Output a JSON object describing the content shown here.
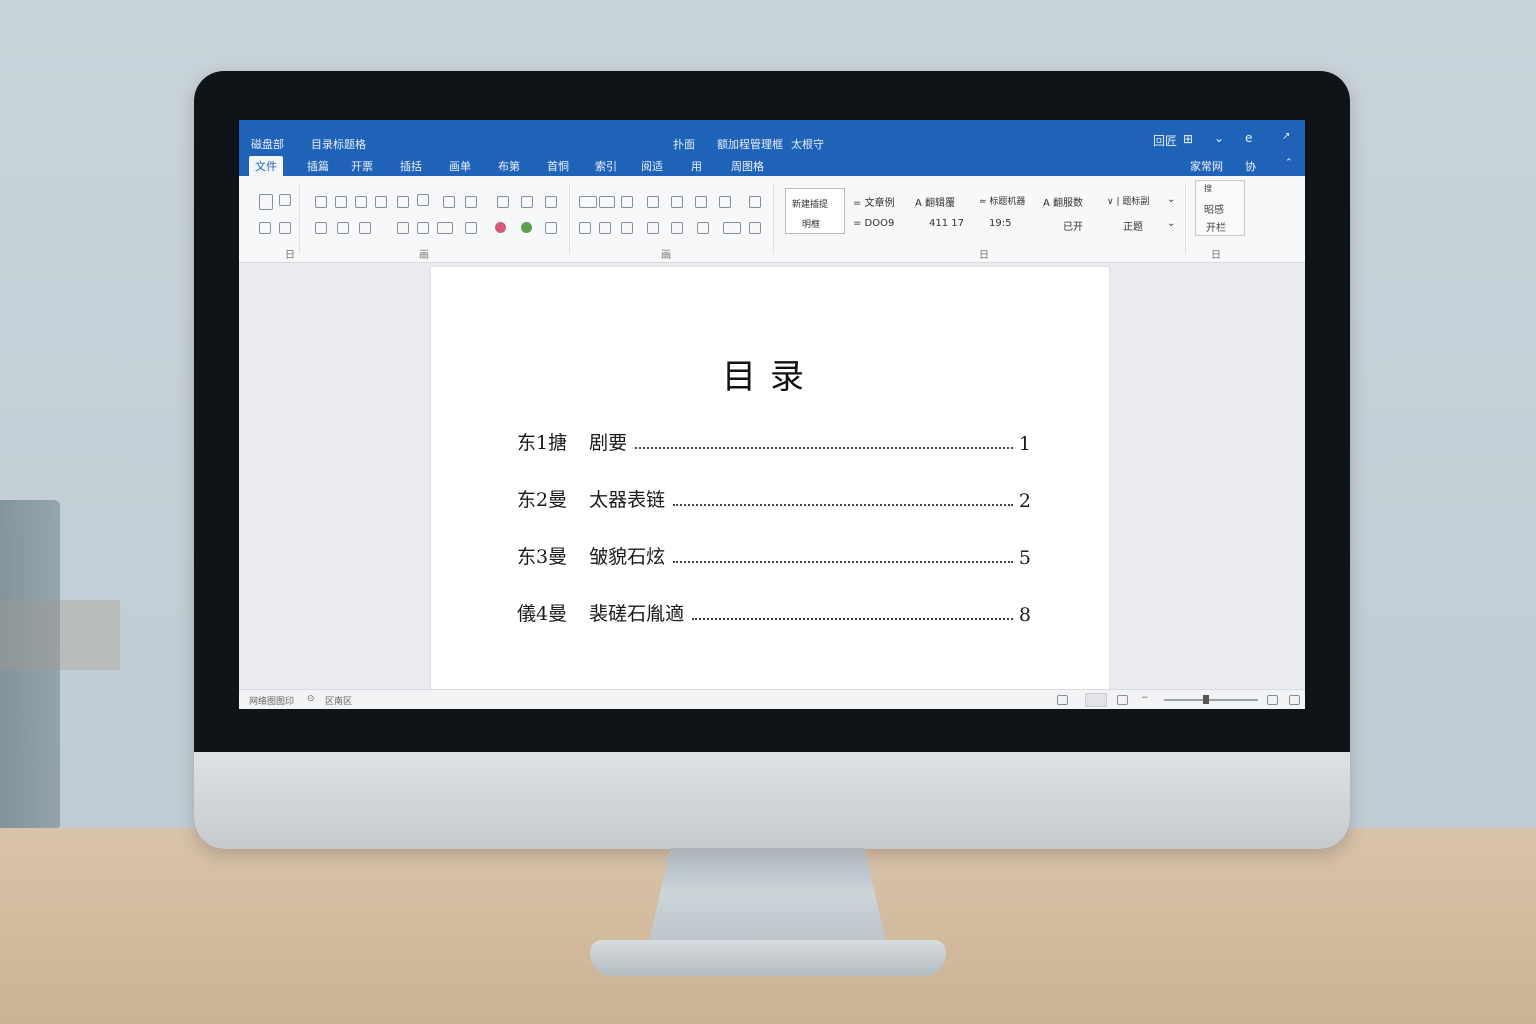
{
  "app": {
    "quick_access": "磁盘部",
    "doc_name": "目录标题格",
    "title_center_1": "扑面",
    "title_center_2": "额加程管理框",
    "title_center_3": "太根守",
    "ctl_left": "回匠",
    "ctl_mid": "⊞",
    "ctl_right": "e"
  },
  "tabs": [
    {
      "label": "文件"
    },
    {
      "label": "插篇"
    },
    {
      "label": "开票"
    },
    {
      "label": "插括"
    },
    {
      "label": "画单"
    },
    {
      "label": "布第"
    },
    {
      "label": "首恫"
    },
    {
      "label": "索引"
    },
    {
      "label": "阅适"
    },
    {
      "label": "用"
    },
    {
      "label": "周图格"
    }
  ],
  "tab_right": {
    "share": "家常网",
    "comments": "协"
  },
  "ribbon": {
    "styles": {
      "card_line1": "新建插提",
      "card_line2": "明框",
      "style_1_top": "= 文章例",
      "style_1_bottom": "= DOO9",
      "style_2_top": "A 翻辑覆",
      "style_2_bottom": "411 17",
      "style_3_top": "≈ 标题机器",
      "style_3_bottom": "19:5",
      "style_4_top": "A 翻服数",
      "style_4_bottom": "已开",
      "style_5_top": "∨ | 题标副",
      "style_5_bottom": "正题"
    },
    "editing": {
      "top": "搜",
      "mid": "昭感",
      "bottom": "开栏"
    },
    "group_labels": [
      "日",
      "画",
      "画",
      "日",
      "日"
    ]
  },
  "document": {
    "title": "目录",
    "toc": [
      {
        "chapter": "东1搪",
        "name": "剧要",
        "page": "1"
      },
      {
        "chapter": "东2曼",
        "name": "太器表链",
        "page": "2"
      },
      {
        "chapter": "东3曼",
        "name": "皱貌石炫",
        "page": "5"
      },
      {
        "chapter": "儀4曼",
        "name": "裴磋石胤適",
        "page": "8"
      }
    ]
  },
  "statusbar": {
    "left": "网络图图印",
    "mid": "区南区"
  }
}
